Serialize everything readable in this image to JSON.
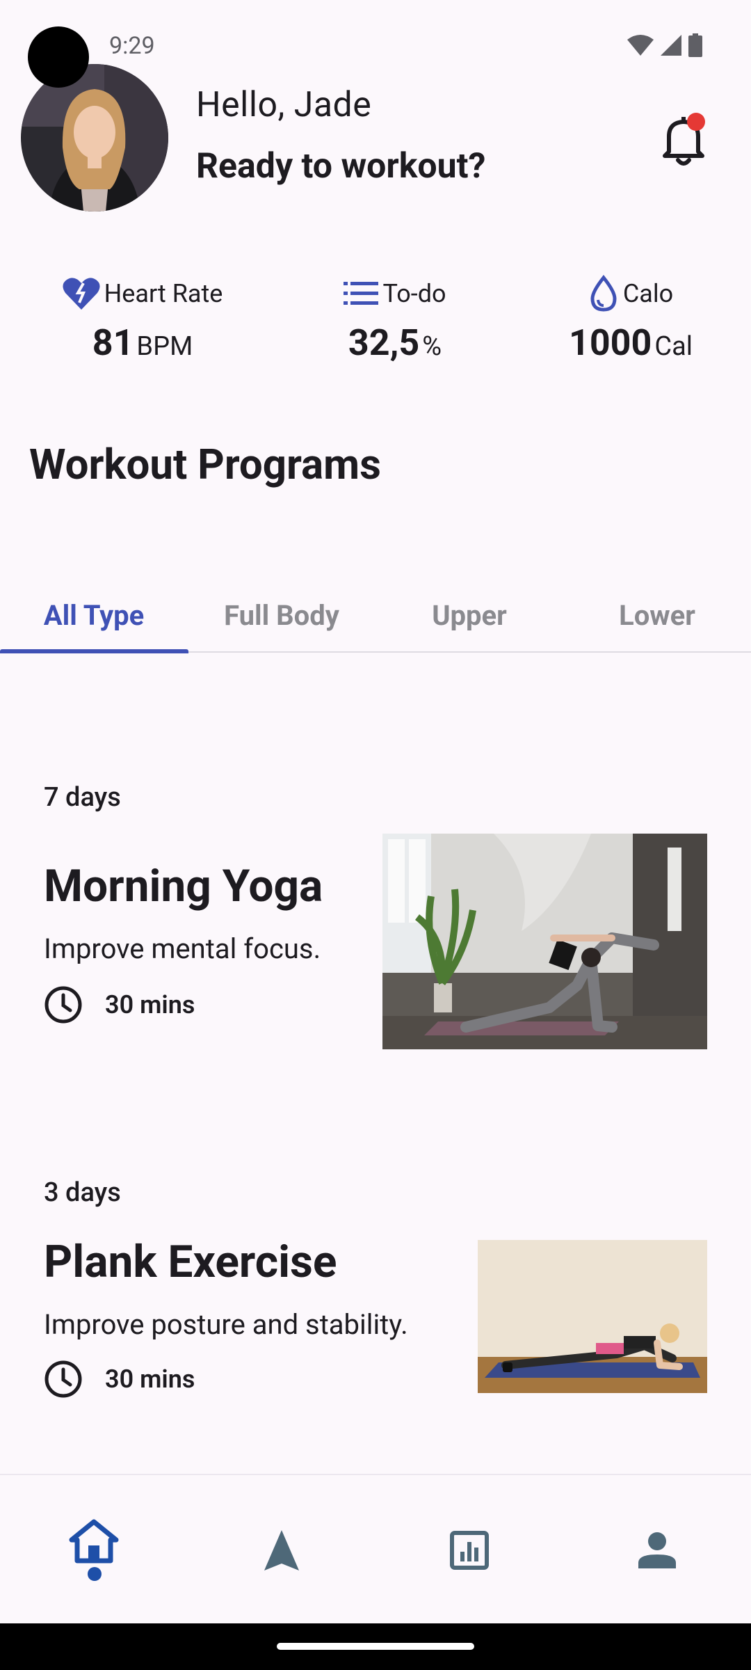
{
  "status_bar": {
    "time": "9:29"
  },
  "header": {
    "greeting": "Hello, Jade",
    "subtitle": "Ready to workout?"
  },
  "stats": [
    {
      "label": "Heart Rate",
      "value": "81",
      "unit": "BPM",
      "icon": "heart-rate-icon"
    },
    {
      "label": "To-do",
      "value": "32,5",
      "unit": "%",
      "icon": "list-icon"
    },
    {
      "label": "Calo",
      "value": "1000",
      "unit": "Cal",
      "icon": "water-drop-icon"
    }
  ],
  "section_title": "Workout Programs",
  "tabs": [
    {
      "label": "All Type",
      "active": true
    },
    {
      "label": "Full Body",
      "active": false
    },
    {
      "label": "Upper",
      "active": false
    },
    {
      "label": "Lower",
      "active": false
    }
  ],
  "programs": [
    {
      "days": "7 days",
      "title": "Morning Yoga",
      "description": "Improve mental focus.",
      "duration": "30 mins"
    },
    {
      "days": "3 days",
      "title": "Plank Exercise",
      "description": "Improve posture and stability.",
      "duration": "30 mins"
    }
  ],
  "bottom_nav": [
    {
      "name": "home",
      "icon": "home-icon",
      "active": true
    },
    {
      "name": "explore",
      "icon": "navigation-icon",
      "active": false
    },
    {
      "name": "stats",
      "icon": "chart-icon",
      "active": false
    },
    {
      "name": "profile",
      "icon": "person-icon",
      "active": false
    }
  ],
  "colors": {
    "accent": "#3f51b5",
    "background": "#fcf8fc",
    "inactive_tab": "#8a8a8f",
    "notification": "#e53935",
    "nav_icon_inactive": "#4e6878"
  }
}
